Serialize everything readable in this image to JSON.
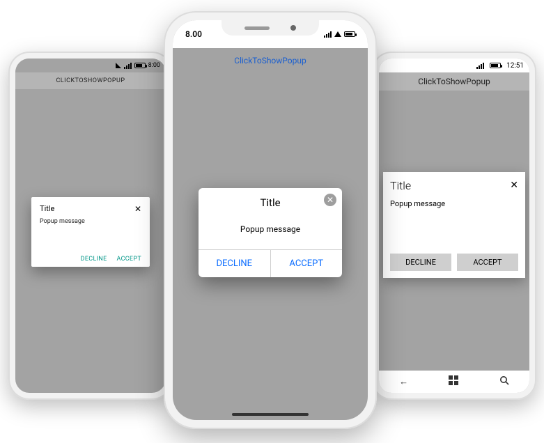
{
  "android": {
    "status_time": "8:00",
    "appbar": "CLICKTOSHOWPOPUP",
    "popup": {
      "title": "Title",
      "message": "Popup message",
      "decline": "DECLINE",
      "accept": "ACCEPT",
      "close_icon": "close-icon"
    }
  },
  "ios": {
    "status_time": "8.00",
    "link": "ClickToShowPopup",
    "popup": {
      "title": "Title",
      "message": "Popup message",
      "decline": "DECLINE",
      "accept": "ACCEPT",
      "close_icon": "close-circle-icon"
    }
  },
  "win": {
    "status_time": "12:51",
    "appbar": "ClickToShowPopup",
    "popup": {
      "title": "Title",
      "message": "Popup message",
      "decline": "DECLINE",
      "accept": "ACCEPT",
      "close_icon": "close-icon"
    },
    "nav": {
      "back": "←",
      "home_icon": "windows-icon",
      "search_icon": "search-icon"
    }
  }
}
